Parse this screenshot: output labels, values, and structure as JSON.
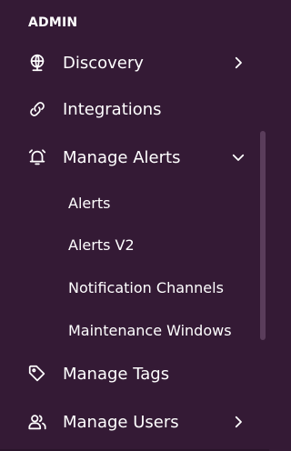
{
  "sidebar": {
    "section_label": "ADMIN",
    "items": [
      {
        "label": "Discovery",
        "icon": "globe-icon",
        "chevron": "chevron-right-icon"
      },
      {
        "label": "Integrations",
        "icon": "link-icon"
      },
      {
        "label": "Manage Alerts",
        "icon": "alarm-bell-icon",
        "chevron": "chevron-down-icon",
        "expanded": true,
        "children": [
          {
            "label": "Alerts"
          },
          {
            "label": "Alerts V2"
          },
          {
            "label": "Notification Channels"
          },
          {
            "label": "Maintenance Windows"
          }
        ]
      },
      {
        "label": "Manage Tags",
        "icon": "tag-icon"
      },
      {
        "label": "Manage Users",
        "icon": "users-icon",
        "chevron": "chevron-right-icon"
      }
    ]
  },
  "colors": {
    "background": "#341a35",
    "text": "#ffffff",
    "scrollbar": "#5a3d5b"
  }
}
